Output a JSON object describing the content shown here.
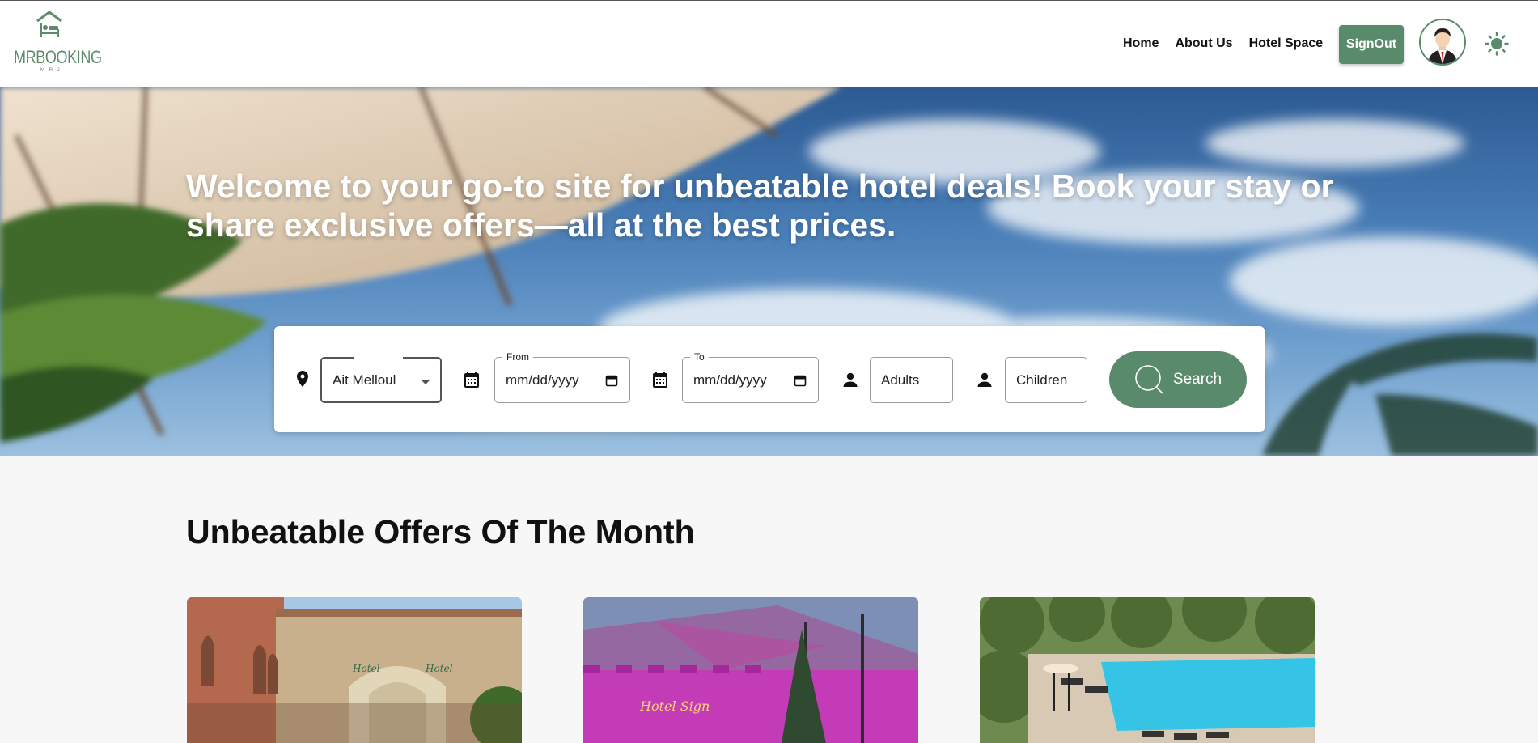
{
  "brand": {
    "name": "MRBOOKING",
    "sub": "M R J"
  },
  "nav": {
    "items": [
      {
        "label": "Home"
      },
      {
        "label": "About Us"
      },
      {
        "label": "Hotel Space"
      }
    ],
    "signout_label": "SignOut"
  },
  "hero": {
    "title": "Welcome to your go-to site for unbeatable hotel deals! Book your stay or share exclusive offers—all at the best prices."
  },
  "search": {
    "city_value": "Ait Melloul",
    "from_legend": "From",
    "from_value": "mm/dd/yyyy",
    "to_legend": "To",
    "to_value": "mm/dd/yyyy",
    "adults_placeholder": "Adults",
    "children_placeholder": "Children",
    "button_label": "Search"
  },
  "offers": {
    "heading": "Unbeatable Offers Of The Month",
    "cards": [
      {
        "image": "hotel-facade-photo"
      },
      {
        "image": "hotel-night-neon-photo"
      },
      {
        "image": "hotel-pool-photo"
      }
    ]
  },
  "colors": {
    "brand_green": "#5a8a6c",
    "header_bg": "#ffffff",
    "page_bg": "#f7f7f7"
  },
  "icons": [
    "bed-icon",
    "location-pin-icon",
    "calendar-icon",
    "person-icon",
    "search-icon",
    "sun-icon"
  ]
}
